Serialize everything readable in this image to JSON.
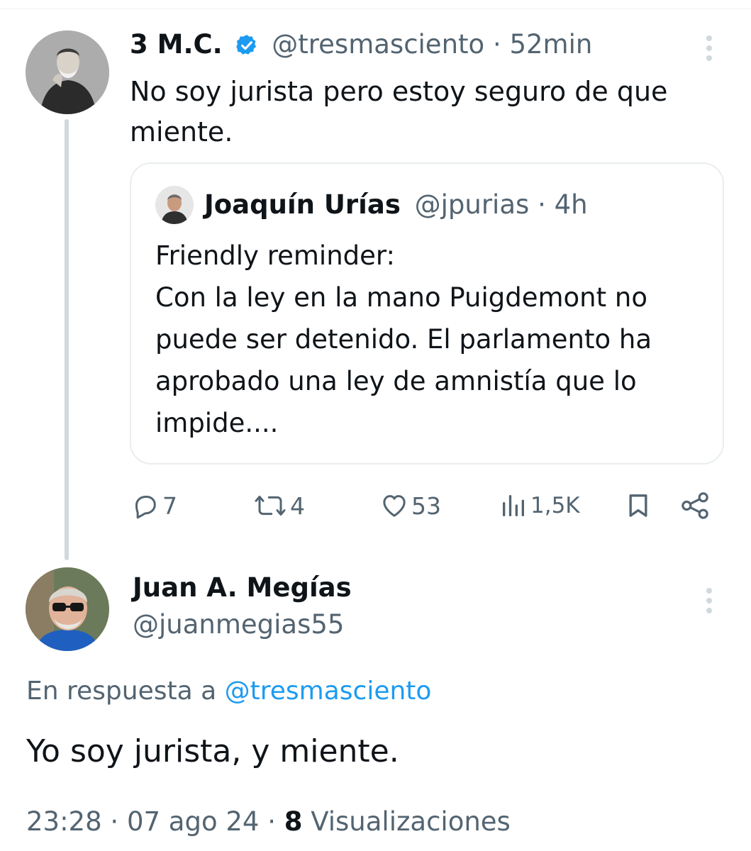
{
  "tweet1": {
    "display_name": "3 M.C.",
    "handle": "@tresmasciento",
    "separator": "·",
    "time": "52min",
    "text_line1": "No soy jurista pero estoy seguro de que",
    "text_line2": "miente.",
    "verified": true
  },
  "quote": {
    "display_name": "Joaquín Urías",
    "handle": "@jpurias",
    "separator": "·",
    "time": "4h",
    "lines": [
      "Friendly reminder:",
      "Con la ley en la mano Puigdemont no",
      "puede ser detenido. El parlamento ha",
      "aprobado una ley de amnistía que lo",
      "impide...."
    ]
  },
  "actions": {
    "replies": "7",
    "retweets": "4",
    "likes": "53",
    "views": "1,5K"
  },
  "tweet2": {
    "display_name": "Juan A. Megías",
    "handle": "@juanmegias55",
    "reply_prefix": "En respuesta a",
    "reply_to": "@tresmasciento",
    "text": "Yo soy jurista, y miente.",
    "time": "23:28",
    "date": "07 ago 24",
    "dot": "·",
    "views_count": "8",
    "views_label": "Visualizaciones"
  },
  "colors": {
    "accent": "#1d9bf0",
    "secondary_text": "#536471",
    "thread_line": "#cfd9de",
    "border": "#e9edef"
  },
  "icons": [
    "verified-badge-icon",
    "reply-icon",
    "retweet-icon",
    "like-icon",
    "views-icon",
    "bookmark-icon",
    "share-icon",
    "more-options-icon"
  ]
}
